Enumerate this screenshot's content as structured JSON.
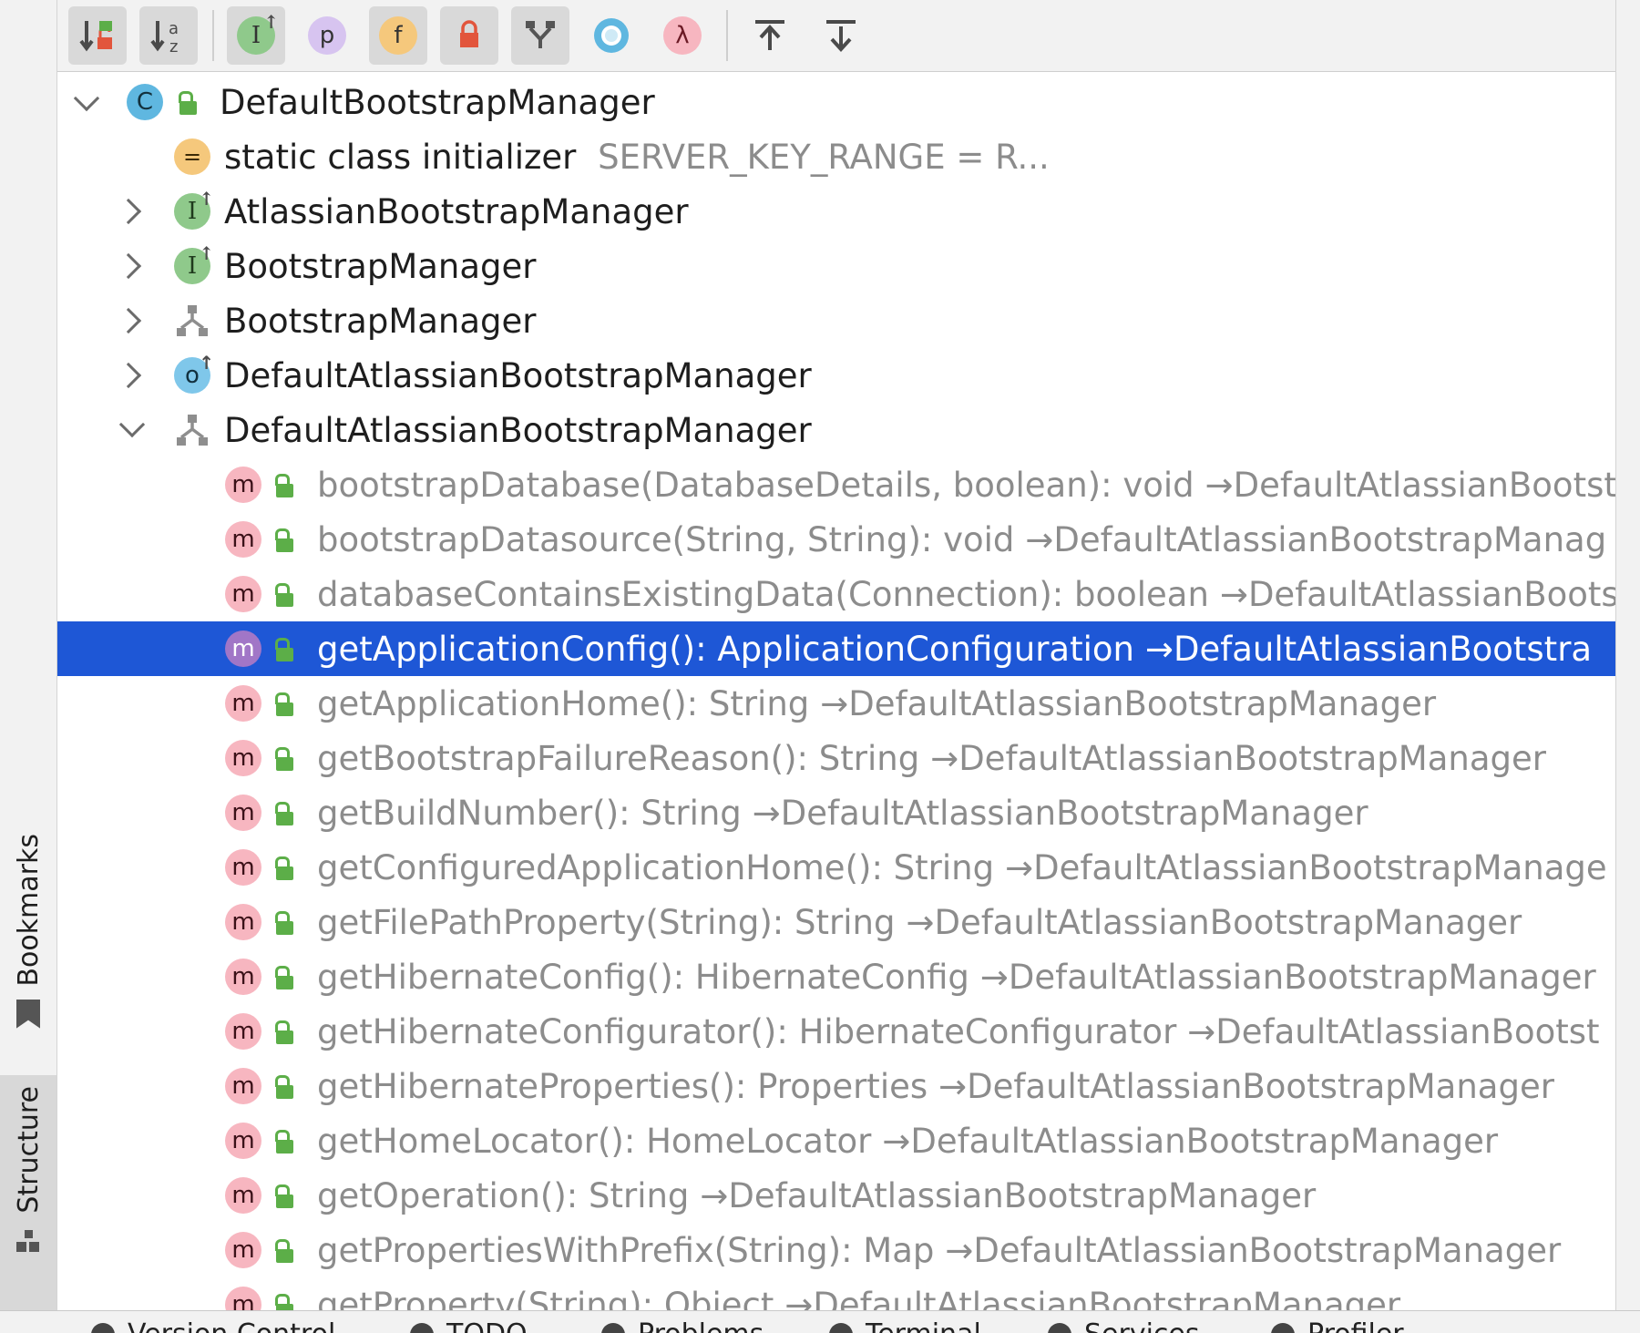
{
  "toolbar": {
    "buttons": [
      {
        "id": "sort-visibility",
        "icon": "sort-by-visibility-icon",
        "active": true
      },
      {
        "id": "sort-alpha",
        "icon": "sort-alphabetically-icon",
        "glyph": "↓a z",
        "active": false
      },
      {
        "id": "show-inherited",
        "icon": "show-inherited-icon",
        "glyph": "I",
        "active": true
      },
      {
        "id": "show-properties",
        "icon": "show-properties-icon",
        "glyph": "p",
        "active": false
      },
      {
        "id": "show-fields",
        "icon": "show-fields-icon",
        "glyph": "f",
        "active": true
      },
      {
        "id": "show-non-public",
        "icon": "show-non-public-icon",
        "active": true
      },
      {
        "id": "group-by-hierarchy",
        "icon": "hierarchy-icon",
        "active": true
      },
      {
        "id": "show-anonymous",
        "icon": "anonymous-classes-icon",
        "active": false
      },
      {
        "id": "show-lambdas",
        "icon": "lambda-icon",
        "glyph": "λ",
        "active": false
      },
      {
        "id": "expand-all",
        "icon": "expand-all-icon",
        "active": false
      },
      {
        "id": "collapse-all",
        "icon": "collapse-all-icon",
        "active": false
      }
    ]
  },
  "sidebar": {
    "bookmarks_label": "Bookmarks",
    "structure_label": "Structure"
  },
  "tree": {
    "root": {
      "name": "DefaultBootstrapManager",
      "icon": "class-icon",
      "glyph": "C",
      "expanded": true
    },
    "items": [
      {
        "kind": "static",
        "icon": "static-initializer-icon",
        "name": "static class initializer",
        "detail": "SERVER_KEY_RANGE = R..."
      },
      {
        "kind": "interface",
        "icon": "interface-icon",
        "glyph": "I",
        "name": "AtlassianBootstrapManager",
        "expandable": true,
        "expanded": false
      },
      {
        "kind": "interface",
        "icon": "interface-icon",
        "glyph": "I",
        "name": "BootstrapManager",
        "expandable": true,
        "expanded": false
      },
      {
        "kind": "hierarchy",
        "icon": "hierarchy-icon",
        "name": "BootstrapManager",
        "expandable": true,
        "expanded": false
      },
      {
        "kind": "override",
        "icon": "overridden-class-icon",
        "glyph": "o",
        "name": "DefaultAtlassianBootstrapManager",
        "expandable": true,
        "expanded": false
      },
      {
        "kind": "hierarchy",
        "icon": "hierarchy-icon",
        "name": "DefaultAtlassianBootstrapManager",
        "expandable": true,
        "expanded": true
      }
    ],
    "methods": [
      {
        "signature": "bootstrapDatabase(DatabaseDetails, boolean): void",
        "origin": "→DefaultAtlassianBootstr"
      },
      {
        "signature": "bootstrapDatasource(String, String): void",
        "origin": "→DefaultAtlassianBootstrapManag"
      },
      {
        "signature": "databaseContainsExistingData(Connection): boolean",
        "origin": "→DefaultAtlassianBoots"
      },
      {
        "signature": "getApplicationConfig(): ApplicationConfiguration",
        "origin": "→DefaultAtlassianBootstra",
        "selected": true
      },
      {
        "signature": "getApplicationHome(): String",
        "origin": "→DefaultAtlassianBootstrapManager"
      },
      {
        "signature": "getBootstrapFailureReason(): String",
        "origin": "→DefaultAtlassianBootstrapManager"
      },
      {
        "signature": "getBuildNumber(): String",
        "origin": "→DefaultAtlassianBootstrapManager"
      },
      {
        "signature": "getConfiguredApplicationHome(): String",
        "origin": "→DefaultAtlassianBootstrapManage"
      },
      {
        "signature": "getFilePathProperty(String): String",
        "origin": "→DefaultAtlassianBootstrapManager"
      },
      {
        "signature": "getHibernateConfig(): HibernateConfig",
        "origin": "→DefaultAtlassianBootstrapManager"
      },
      {
        "signature": "getHibernateConfigurator(): HibernateConfigurator",
        "origin": "→DefaultAtlassianBootst"
      },
      {
        "signature": "getHibernateProperties(): Properties",
        "origin": "→DefaultAtlassianBootstrapManager"
      },
      {
        "signature": "getHomeLocator(): HomeLocator",
        "origin": "→DefaultAtlassianBootstrapManager"
      },
      {
        "signature": "getOperation(): String",
        "origin": "→DefaultAtlassianBootstrapManager"
      },
      {
        "signature": "getPropertiesWithPrefix(String): Map",
        "origin": "→DefaultAtlassianBootstrapManager"
      },
      {
        "signature": "getProperty(String): Object",
        "origin": "→DefaultAtlassianBootstrapManager"
      }
    ],
    "method_glyph": "m"
  },
  "statusbar": {
    "items": [
      "Version Control",
      "TODO",
      "Problems",
      "Terminal",
      "Services",
      "Profiler"
    ]
  },
  "colors": {
    "selection": "#1e57d6",
    "method_icon": "#f7b6c0",
    "interface_icon": "#8fc98b",
    "class_icon": "#5fb7e0",
    "lock_green": "#5cae48"
  }
}
